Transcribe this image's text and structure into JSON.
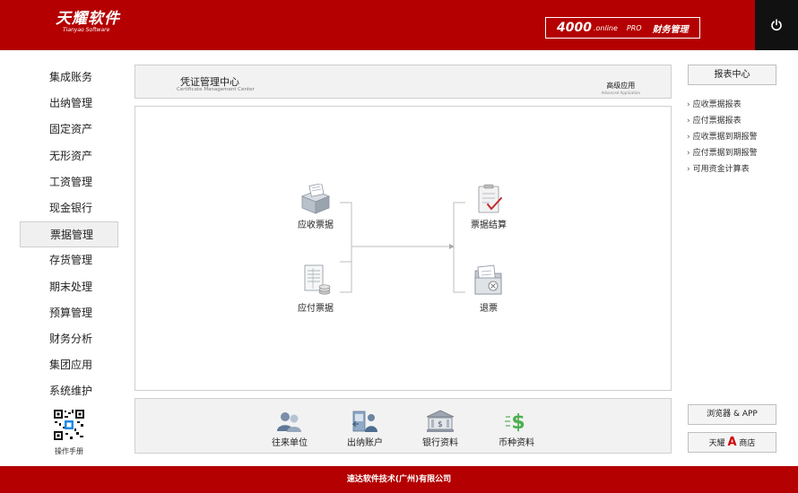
{
  "header": {
    "logo_cn": "天耀软件",
    "logo_en": "Tianyao Software",
    "product_number": "4000",
    "product_suffix": ".online",
    "product_edition": "PRO",
    "product_module": "财务管理",
    "power_icon": "power-icon"
  },
  "nav": {
    "items": [
      {
        "label": "集成账务"
      },
      {
        "label": "出纳管理"
      },
      {
        "label": "固定资产"
      },
      {
        "label": "无形资产"
      },
      {
        "label": "工资管理"
      },
      {
        "label": "现金银行"
      },
      {
        "label": "票据管理",
        "active": true
      },
      {
        "label": "存货管理"
      },
      {
        "label": "期末处理"
      },
      {
        "label": "预算管理"
      },
      {
        "label": "财务分析"
      },
      {
        "label": "集团应用"
      },
      {
        "label": "系统维护"
      }
    ],
    "manual_label": "操作手册"
  },
  "title_bar": {
    "title": "凭证管理中心",
    "subtitle": "Certificate Management Center",
    "advanced": "高级应用",
    "advanced_en": "Advanced Application"
  },
  "flow": {
    "nodes": {
      "receivable": "应收票据",
      "payable": "应付票据",
      "settle": "票据结算",
      "refund": "退票"
    }
  },
  "tools": [
    {
      "label": "往来单位",
      "icon": "contacts-icon"
    },
    {
      "label": "出纳账户",
      "icon": "cashier-account-icon"
    },
    {
      "label": "银行资料",
      "icon": "bank-icon"
    },
    {
      "label": "币种资料",
      "icon": "currency-icon"
    }
  ],
  "right": {
    "report_center": "报表中心",
    "reports": [
      {
        "label": "应收票据报表"
      },
      {
        "label": "应付票据报表"
      },
      {
        "label": "应收票据到期报警"
      },
      {
        "label": "应付票据到期报警"
      },
      {
        "label": "可用资金计算表"
      }
    ],
    "browser_app": "浏览器 & APP",
    "store_prefix": "天耀",
    "store_a": "A",
    "store_suffix": "商店"
  },
  "footer": {
    "company": "速达软件技术(广州)有限公司"
  },
  "colors": {
    "brand_red": "#b40000",
    "panel_bg": "#f2f2f2",
    "border": "#cfcfcf"
  }
}
